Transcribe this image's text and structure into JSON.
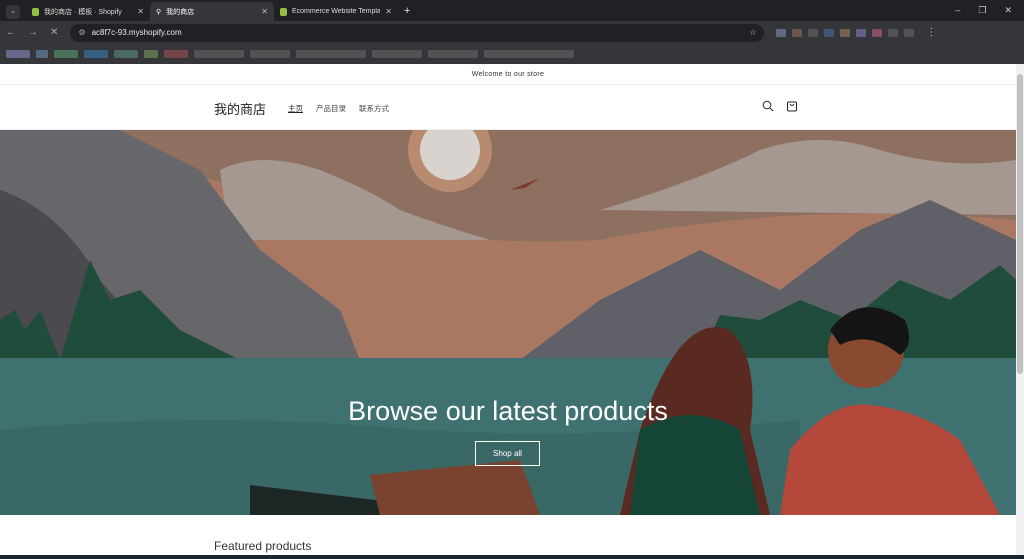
{
  "browser": {
    "tabs": [
      {
        "label": "我的商店 · 模板 · Shopify",
        "active": false
      },
      {
        "label": "我的商店",
        "active": true
      },
      {
        "label": "Ecommerce Website Templat",
        "active": false
      }
    ],
    "new_tab": "+",
    "close": "✕",
    "url": "ac8f7c-93.myshopify.com",
    "window": {
      "min": "–",
      "max": "❐",
      "close": "✕"
    }
  },
  "store": {
    "announcement": "Welcome to our store",
    "logo": "我的商店",
    "nav": [
      "主页",
      "产品目录",
      "联系方式"
    ],
    "hero": {
      "title": "Browse our latest products",
      "button": "Shop all"
    },
    "featured_title": "Featured products"
  },
  "colors": {
    "sky": "#a97862",
    "water": "#3f7170",
    "accent": "#95bf47"
  }
}
